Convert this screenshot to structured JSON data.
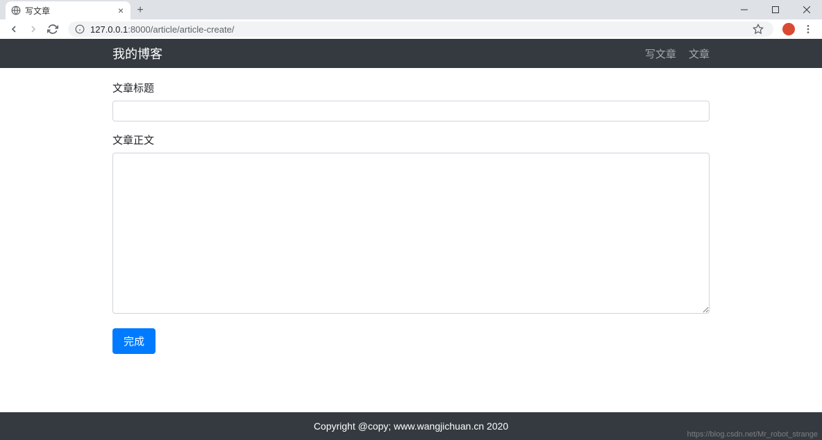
{
  "browser": {
    "tab_title": "写文章",
    "url_host": "127.0.0.1",
    "url_port": ":8000",
    "url_path": "/article/article-create/"
  },
  "navbar": {
    "brand": "我的博客",
    "links": [
      "写文章",
      "文章"
    ]
  },
  "form": {
    "title_label": "文章标题",
    "title_value": "",
    "body_label": "文章正文",
    "body_value": "",
    "submit_label": "完成"
  },
  "footer": {
    "copyright": "Copyright @copy; www.wangjichuan.cn 2020",
    "watermark": "https://blog.csdn.net/Mr_robot_strange"
  }
}
